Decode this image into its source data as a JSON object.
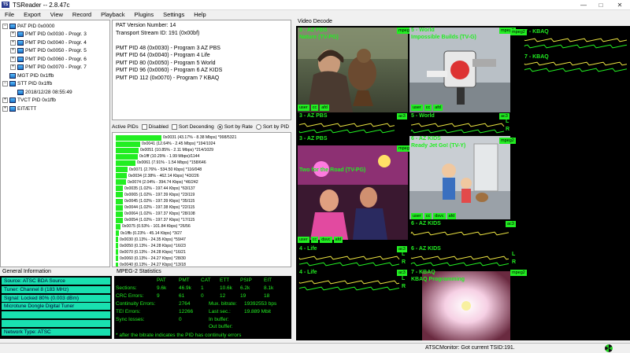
{
  "window": {
    "title": "TSReader -- 2.8.47c",
    "icon": "app-icon"
  },
  "menu": [
    "File",
    "Export",
    "View",
    "Record",
    "Playback",
    "Plugins",
    "Settings",
    "Help"
  ],
  "tree": {
    "items": [
      {
        "label": "PAT PID 0x0000",
        "level": 0,
        "exp": "−"
      },
      {
        "label": "PMT PID 0x0030 - Progr. 3",
        "level": 1,
        "exp": "+"
      },
      {
        "label": "PMT PID 0x0040 - Progr. 4",
        "level": 1,
        "exp": "+"
      },
      {
        "label": "PMT PID 0x0050 - Progr. 5",
        "level": 1,
        "exp": "+"
      },
      {
        "label": "PMT PID 0x0060 - Progr. 6",
        "level": 1,
        "exp": "+"
      },
      {
        "label": "PMT PID 0x0070 - Progr. 7",
        "level": 1,
        "exp": "+"
      },
      {
        "label": "MGT PID 0x1ffb",
        "level": 0,
        "exp": ""
      },
      {
        "label": "STT PID 0x1ffb",
        "level": 0,
        "exp": "−"
      },
      {
        "label": "2018/12/28 08:55:49",
        "level": 1,
        "exp": ""
      },
      {
        "label": "TVCT PID 0x1ffb",
        "level": 0,
        "exp": "+"
      },
      {
        "label": "EIT/ETT",
        "level": 0,
        "exp": "+"
      }
    ]
  },
  "pat": {
    "lines": [
      "PAT Version Number: 14",
      "Transport Stream ID: 191 (0x00bf)",
      "",
      "PMT PID 48 (0x0030) - Program 3 AZ PBS",
      "PMT PID 64 (0x0040) - Program 4 Life",
      "PMT PID 80 (0x0050) - Program 5 World",
      "PMT PID 96 (0x0060) - Program 6 AZ KIDS",
      "PMT PID 112 (0x0070) - Program 7 KBAQ"
    ]
  },
  "active_pids": {
    "label": "Active PIDs",
    "disabled_label": "Disabled",
    "sort_desc_label": "Sort Decending",
    "sort_rate_label": "Sort by Rate",
    "sort_pid_label": "Sort by PID",
    "sort_selected": "rate",
    "rows": [
      {
        "text": "0x0031 (43.17% - 8.38 Mbps) *998/5321",
        "share": 0.4317
      },
      {
        "text": "0x0041 (12.64% - 2.45 Mbps) *194/1024",
        "share": 0.1264
      },
      {
        "text": "0x0051 (10.85% - 2.11 Mbps) *214/1029",
        "share": 0.1085
      },
      {
        "text": "0x1fff (10.29% - 1.99 Mbps)/1144",
        "share": 0.1029
      },
      {
        "text": "0x0061 (7.91% - 1.54 Mbps) *158/646",
        "share": 0.0791
      },
      {
        "text": "0x0071 (2.76% - 534.50 Kbps) *116/048",
        "share": 0.0276
      },
      {
        "text": "0x0034 (2.38% - 462.14 Kbps) *43/226",
        "share": 0.0238
      },
      {
        "text": "0x0074 (2.04% - 394.74 Kbps) *46/242",
        "share": 0.0204
      },
      {
        "text": "0x0035 (1.02% - 197.44 Kbps) *63/137",
        "share": 0.0102
      },
      {
        "text": "0x0065 (1.02% - 197.39 Kbps) *23/119",
        "share": 0.0102
      },
      {
        "text": "0x0045 (1.02% - 197.39 Kbps) *35/115",
        "share": 0.0102
      },
      {
        "text": "0x0044 (1.02% - 197.38 Kbps) *22/115",
        "share": 0.0102
      },
      {
        "text": "0x0064 (1.02% - 197.37 Kbps) *28/108",
        "share": 0.0102
      },
      {
        "text": "0x0054 (1.02% - 197.37 Kbps) *17/115",
        "share": 0.0102
      },
      {
        "text": "0x0075 (0.53% - 101.84 Kbps) *26/56",
        "share": 0.0053
      },
      {
        "text": "0x1ffb (0.23% - 45.14 Kbps) *3/27",
        "share": 0.0023
      },
      {
        "text": "0x0030 (0.13% - 24.35 Kbps) *59/47",
        "share": 0.0013
      },
      {
        "text": "0x0050 (0.13% - 24.28 Kbps) *16/23",
        "share": 0.0013
      },
      {
        "text": "0x0070 (0.13% - 24.28 Kbps) *16/21",
        "share": 0.0013
      },
      {
        "text": "0x0060 (0.13% - 24.27 Kbps) *28/30",
        "share": 0.0013
      },
      {
        "text": "0x0040 (0.13% - 24.27 Kbps) *13/18",
        "share": 0.0013
      }
    ]
  },
  "general_info": {
    "label": "General Information",
    "rows": [
      "Source: ATSC BDA Source",
      "Tuner: Channel 8 (183 MHz)",
      "Signal: Locked 80% (0.003 dBm)",
      "Microtune Dongle Digital Tuner",
      "",
      "",
      "Network Type: ATSC"
    ]
  },
  "mpeg2_stats": {
    "label": "MPEG-2 Statistics",
    "cols": [
      "PAT",
      "PMT",
      "CAT",
      "ETT",
      "PSIP",
      "EIT"
    ],
    "rows": [
      {
        "label": "Sections:",
        "values": [
          "9.6k",
          "46.9k",
          "1",
          "10.6k",
          "6.2k",
          "8.1k"
        ]
      },
      {
        "label": "CRC Errors:",
        "values": [
          "9",
          "61",
          "0",
          "12",
          "19",
          "18"
        ]
      }
    ],
    "continuity_label": "Continuity Errors:",
    "continuity_value": "2764",
    "mux_label": "Mux. bitrate:",
    "mux_value": "19392553 bps",
    "tei_label": "TEI Errors:",
    "tei_value": "12266",
    "lastsec_label": "Last sec.:",
    "lastsec_value": "19.889 Mbit",
    "sync_label": "Sync losses:",
    "sync_value": "0",
    "inbuf_label": "In buffer:",
    "outbuf_label": "Out buffer:",
    "footnote": "* after the bitrate indicates the PID has continuity errors"
  },
  "video": {
    "label": "Video Decode",
    "tiles": [
      {
        "label": "3 - AZ PBS",
        "sub": "Nature (TV-PG)",
        "codec": "mpeg2",
        "tags": [
          "user",
          "cc",
          "afd"
        ],
        "audio": "ac3",
        "audio_label": "3 - AZ PBS"
      },
      {
        "label": "5 - World",
        "sub": "Impossible Builds (TV-G)",
        "codec": "mpeg2",
        "tags": [
          "user",
          "cc",
          "afd"
        ],
        "audio": "ac3",
        "audio_label": "5 - World"
      },
      {
        "label": "7 - KBAQ",
        "sub": "",
        "codec": "mpeg2",
        "tags": [],
        "audio": "",
        "audio_label": "7 - KBAQ"
      },
      {
        "label": "3 - AZ PBS",
        "sub": "Two for the Road (TV-PG)",
        "codec": "mpeg2",
        "tags": [
          "user",
          "cc",
          "dsvc",
          "afd"
        ],
        "audio": "ac3",
        "audio_label": "4 - Life"
      },
      {
        "label": "6 - AZ KIDS",
        "sub": "Ready Jet Go! (TV-Y)",
        "codec": "mpeg2",
        "tags": [
          "user",
          "cc",
          "dsvc",
          "afd"
        ],
        "audio": "ac3",
        "audio_label": "6 - AZ KIDS"
      },
      {
        "label": "4 - Life",
        "sub": "",
        "codec": "ac3",
        "tags": [],
        "audio": "",
        "audio_label": "4 - Life"
      },
      {
        "label": "7 - KBAQ",
        "sub": "KBAQ Programming",
        "codec": "mpeg2",
        "tags": [],
        "audio": "",
        "audio_label": ""
      }
    ],
    "lr": [
      "L",
      "R"
    ]
  },
  "status": {
    "text": "ATSCMonitor: Got current TSID:191.",
    "icon": "network-status-icon"
  },
  "colors": {
    "green": "#22ee22",
    "info_cyan": "#19e0b0"
  }
}
